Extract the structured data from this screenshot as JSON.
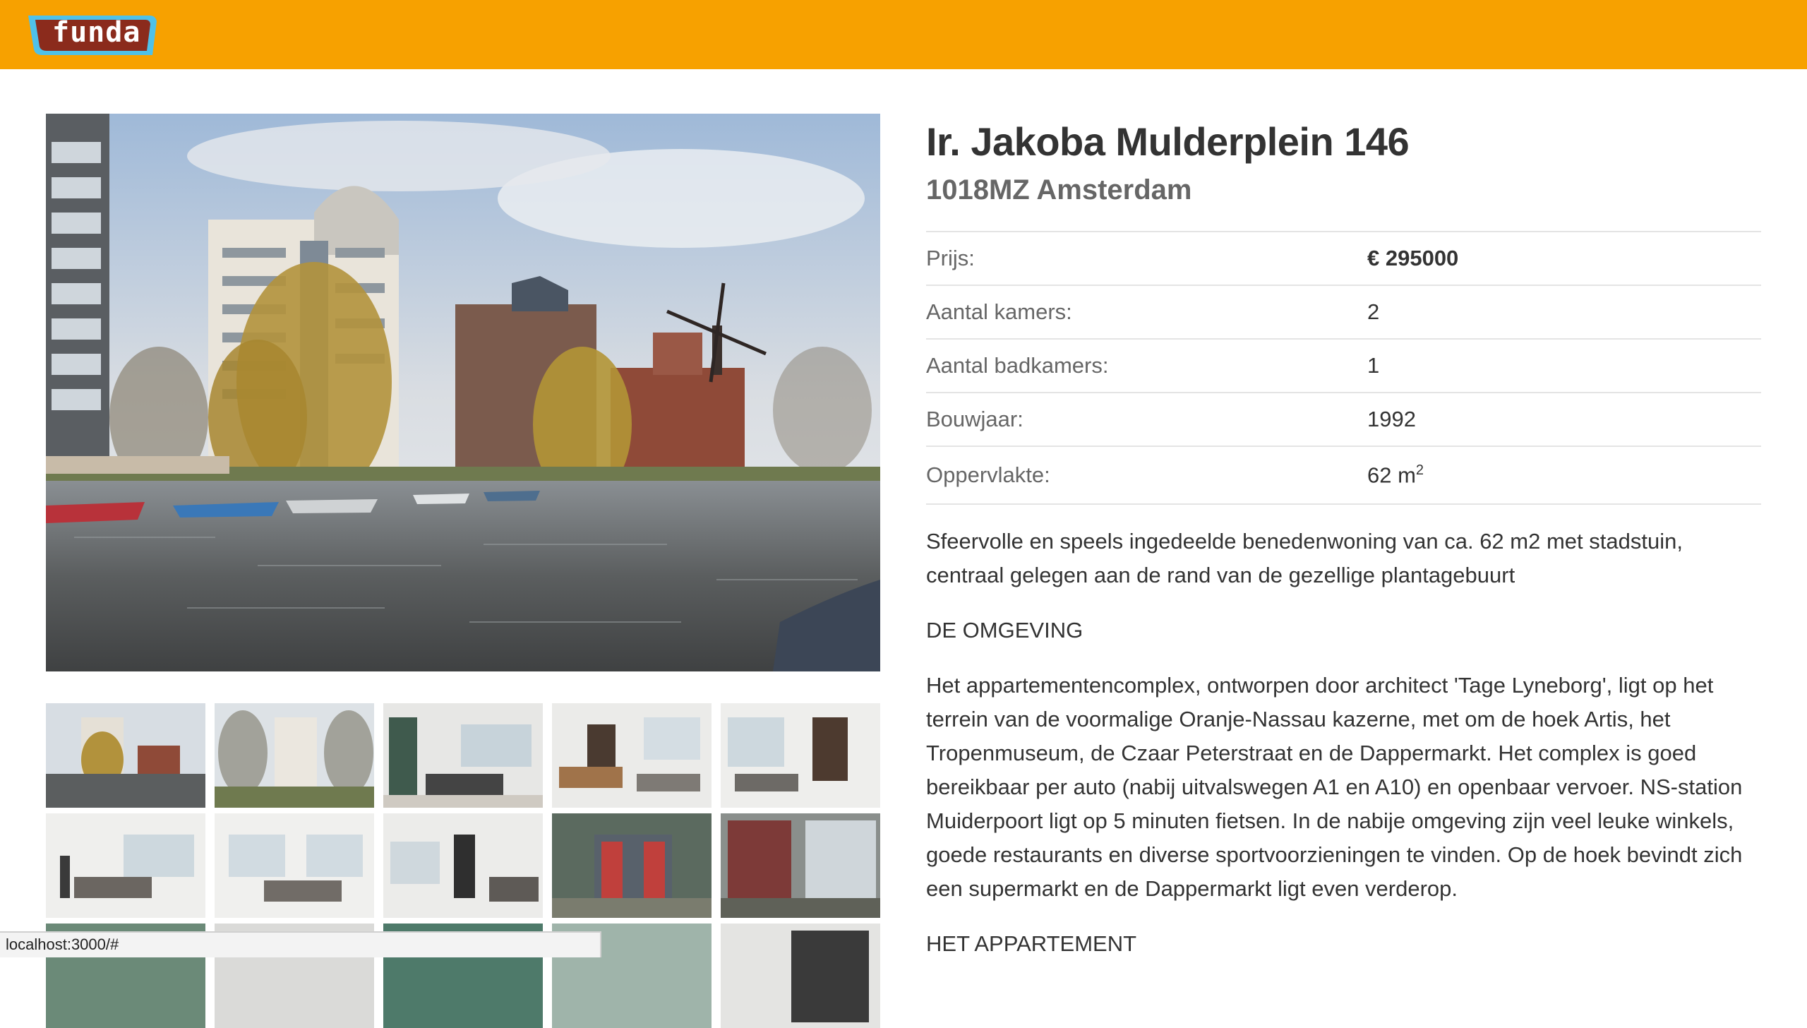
{
  "colors": {
    "brand": "#f7a100",
    "logo_fill": "#8b2b1c",
    "logo_outline": "#4fc1e9",
    "text": "#333333",
    "muted": "#666666",
    "divider": "#e4e4e4"
  },
  "header": {
    "logo_text": "funda"
  },
  "gallery": {
    "thumb_count": 15
  },
  "listing": {
    "title": "Ir. Jakoba Mulderplein 146",
    "subtitle": "1018MZ Amsterdam",
    "facts": [
      {
        "label": "Prijs:",
        "value": "€ 295000"
      },
      {
        "label": "Aantal kamers:",
        "value": "2"
      },
      {
        "label": "Aantal badkamers:",
        "value": "1"
      },
      {
        "label": "Bouwjaar:",
        "value": "1992"
      },
      {
        "label": "Oppervlakte:",
        "value": "62 m",
        "sup": "2"
      }
    ],
    "intro": "Sfeervolle en speels ingedeelde benedenwoning van ca. 62 m2 met stadstuin, centraal gelegen aan de rand van de gezellige plantagebuurt",
    "sections": [
      {
        "heading": "DE OMGEVING",
        "text": "Het appartementencomplex, ontworpen door architect 'Tage Lyneborg', ligt op het terrein van de voormalige Oranje-Nassau kazerne, met om de hoek Artis, het Tropenmuseum, de Czaar Peterstraat en de Dappermarkt. Het complex is goed bereikbaar per auto (nabij uitvalswegen A1 en A10) en openbaar vervoer. NS-station Muiderpoort ligt op 5 minuten fietsen. In de nabije omgeving zijn veel leuke winkels, goede restaurants en diverse sportvoorzieningen te vinden. Op de hoek bevindt zich een supermarkt en de Dappermarkt ligt even verderop."
      },
      {
        "heading": "HET APPARTEMENT"
      }
    ]
  },
  "status_bar": {
    "url": "localhost:3000/#"
  }
}
